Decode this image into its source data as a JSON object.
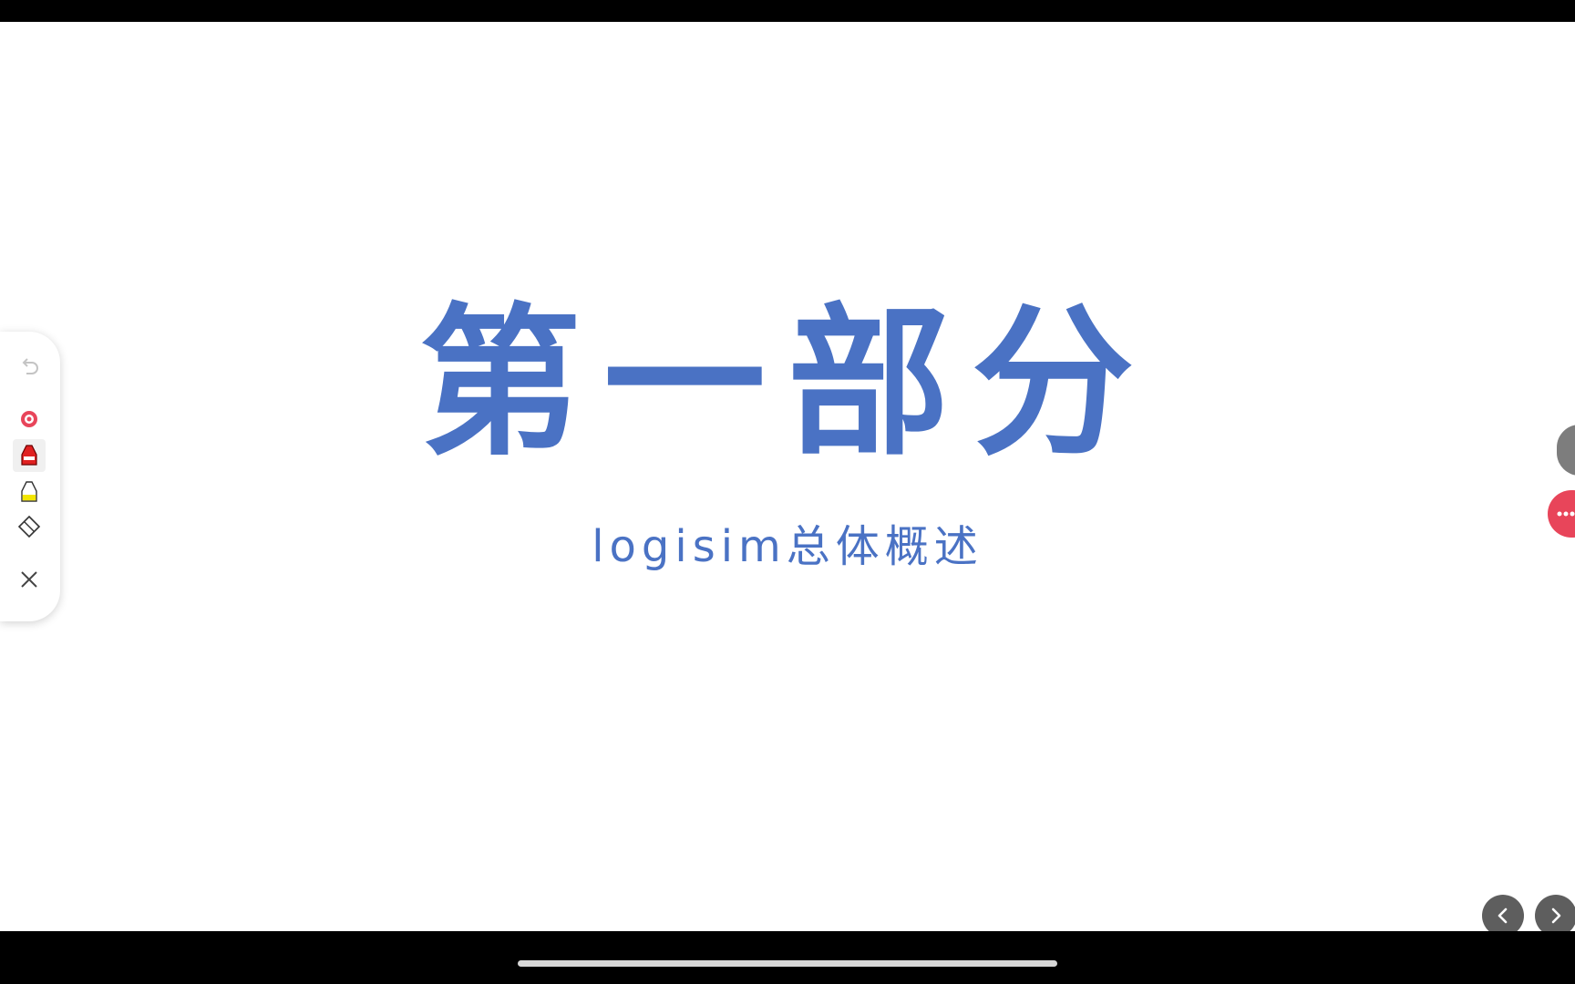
{
  "slide": {
    "title": "第一部分",
    "subtitle": "logisim总体概述"
  },
  "toolbar": {
    "tools": [
      {
        "name": "undo-icon"
      },
      {
        "name": "laser-pointer-icon",
        "color": "#e8455a"
      },
      {
        "name": "red-pen-icon",
        "color": "#e02020"
      },
      {
        "name": "highlighter-icon",
        "color": "#f3e600"
      },
      {
        "name": "eraser-icon"
      },
      {
        "name": "close-icon"
      }
    ]
  },
  "navigation": {
    "previous": "chevron-left-icon",
    "next": "chevron-right-icon"
  },
  "colors": {
    "accent": "#4a72c4",
    "badge": "#e8455a",
    "nav_button": "#5e5e5e"
  }
}
